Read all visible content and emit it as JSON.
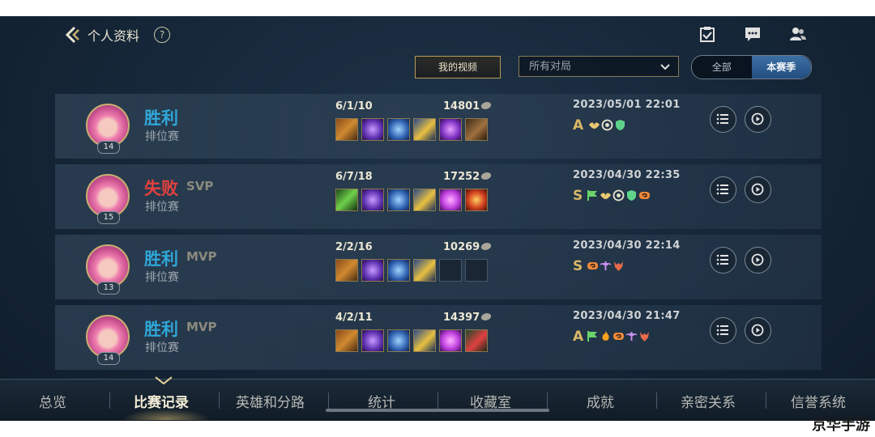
{
  "header": {
    "title": "个人资料",
    "help": "?"
  },
  "filters": {
    "video_button": "我的视频",
    "match_filter": "所有对局",
    "season_toggle": {
      "all": "全部",
      "current": "本赛季"
    }
  },
  "matches": [
    {
      "result": "胜利",
      "badge": "",
      "mode": "排位赛",
      "level": "14",
      "kda": "6/1/10",
      "gold": "14801",
      "time": "2023/05/01 22:01",
      "grade": "A"
    },
    {
      "result": "失败",
      "badge": "SVP",
      "mode": "排位赛",
      "level": "15",
      "kda": "6/7/18",
      "gold": "17252",
      "time": "2023/04/30 22:35",
      "grade": "S"
    },
    {
      "result": "胜利",
      "badge": "MVP",
      "mode": "排位赛",
      "level": "13",
      "kda": "2/2/16",
      "gold": "10269",
      "time": "2023/04/30 22:14",
      "grade": "S"
    },
    {
      "result": "胜利",
      "badge": "MVP",
      "mode": "排位赛",
      "level": "14",
      "kda": "4/2/11",
      "gold": "14397",
      "time": "2023/04/30 21:47",
      "grade": "A"
    }
  ],
  "bottom_nav": [
    "总览",
    "比赛记录",
    "英雄和分路",
    "统计",
    "收藏室",
    "成就",
    "亲密关系",
    "信誉系统"
  ],
  "watermark": "京华手游",
  "colors": {
    "win": "#2fa7d9",
    "lose": "#e3413f",
    "gold_accent": "#d9b766",
    "active_toggle": "#2f62a0"
  }
}
